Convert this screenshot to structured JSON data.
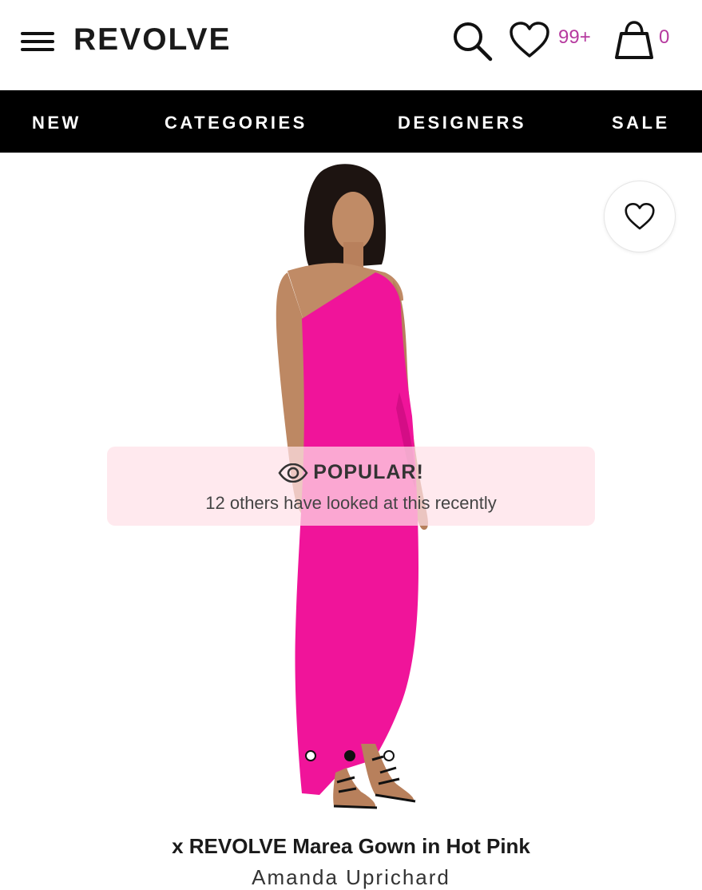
{
  "header": {
    "logo": "REVOLVE",
    "wishlist_count": "99+",
    "bag_count": "0"
  },
  "nav": {
    "items": [
      "NEW",
      "CATEGORIES",
      "DESIGNERS",
      "SALE"
    ]
  },
  "product": {
    "image_count": 3,
    "active_image_index": 1,
    "popular_label": "POPULAR!",
    "popular_text": "12 others have looked at this recently",
    "title": "x REVOLVE Marea Gown in Hot Pink",
    "designer": "Amanda Uprichard"
  },
  "colors": {
    "accent": "#b63a9f",
    "nav_bg": "#000000",
    "dress": "#f0149a"
  },
  "icons": [
    "menu-icon",
    "search-icon",
    "heart-icon",
    "bag-icon",
    "eye-icon"
  ]
}
